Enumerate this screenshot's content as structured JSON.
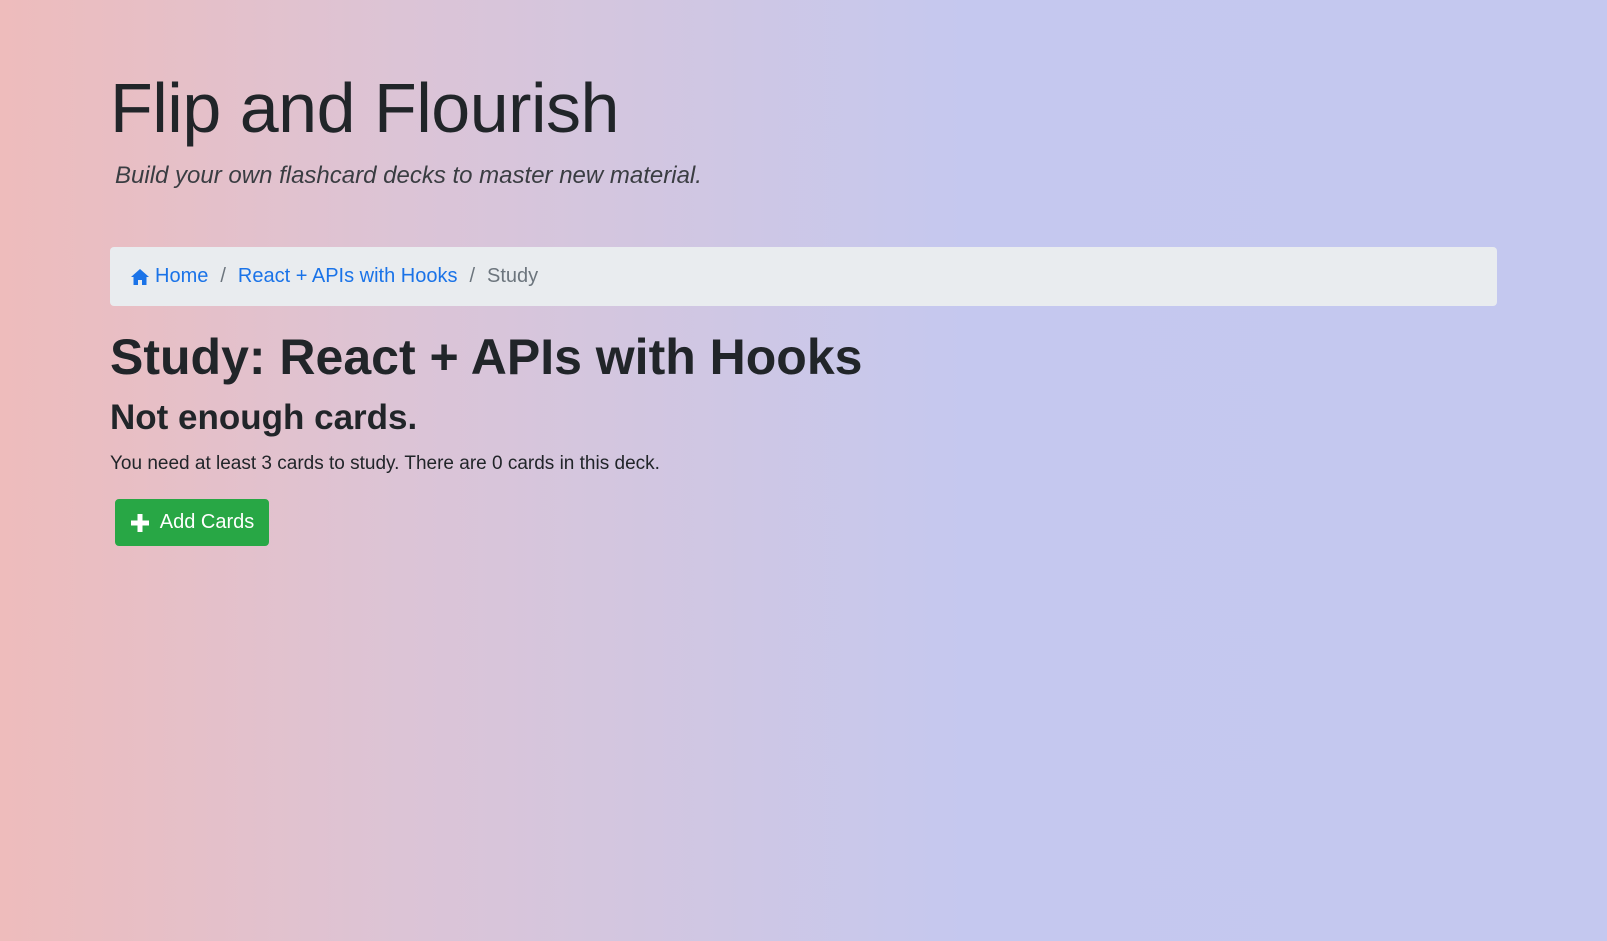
{
  "header": {
    "title": "Flip and Flourish",
    "subtitle": "Build your own flashcard decks to master new material."
  },
  "breadcrumb": {
    "home": "Home",
    "deck": "React + APIs with Hooks",
    "current": "Study",
    "separator": "/"
  },
  "main": {
    "title": "Study: React + APIs with Hooks",
    "heading": "Not enough cards.",
    "message": "You need at least 3 cards to study. There are 0 cards in this deck.",
    "add_button_label": "Add Cards"
  },
  "colors": {
    "link": "#1a73e8",
    "success": "#28a745",
    "breadcrumb_bg": "#e9ecef"
  },
  "icons": {
    "home": "home-icon",
    "add": "plus-icon"
  }
}
